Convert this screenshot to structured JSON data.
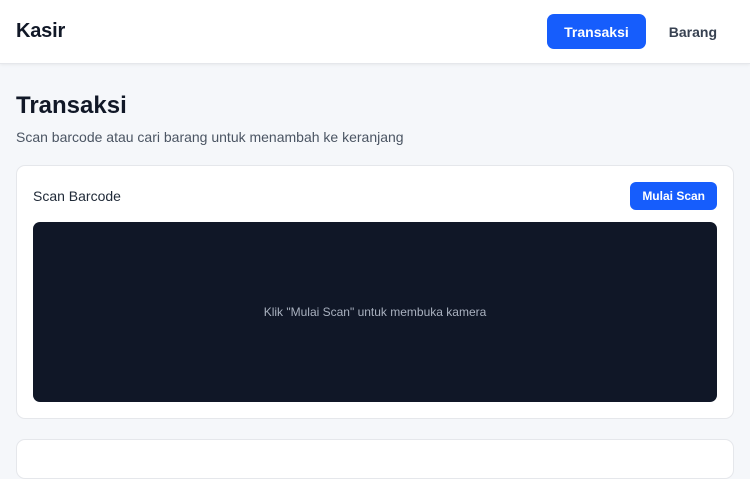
{
  "header": {
    "brand": "Kasir",
    "nav": [
      {
        "label": "Transaksi",
        "active": true
      },
      {
        "label": "Barang",
        "active": false
      }
    ]
  },
  "page": {
    "title": "Transaksi",
    "subtitle": "Scan barcode atau cari barang untuk menambah ke keranjang"
  },
  "scanner": {
    "title": "Scan Barcode",
    "start_button": "Mulai Scan",
    "camera_hint": "Klik \"Mulai Scan\" untuk membuka kamera"
  },
  "colors": {
    "accent": "#165dfc",
    "camera_bg": "#101727",
    "page_bg": "#f5f7fa"
  }
}
